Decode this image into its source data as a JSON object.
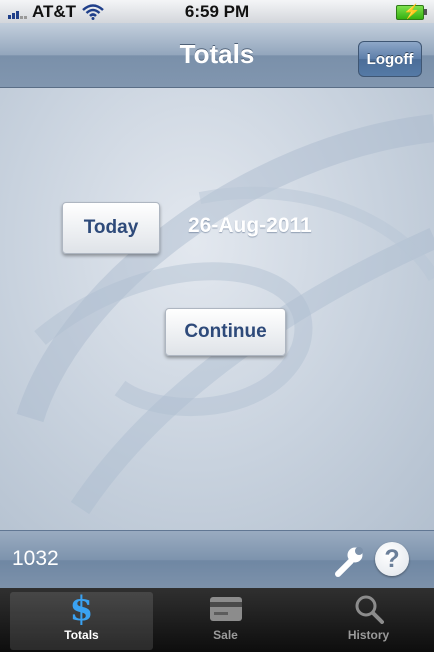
{
  "status_bar": {
    "carrier": "AT&T",
    "time": "6:59 PM"
  },
  "nav": {
    "title": "Totals",
    "logoff_label": "Logoff"
  },
  "main": {
    "today_label": "Today",
    "date": "26-Aug-2011",
    "continue_label": "Continue"
  },
  "info_bar": {
    "code": "1032",
    "help_glyph": "?"
  },
  "tabs": [
    {
      "label": "Totals",
      "icon": "dollar-icon",
      "active": true
    },
    {
      "label": "Sale",
      "icon": "card-icon",
      "active": false
    },
    {
      "label": "History",
      "icon": "search-icon",
      "active": false
    }
  ],
  "colors": {
    "nav_blue": "#8196af",
    "button_text": "#2e4a7a",
    "active_tab_icon": "#3aa2f2"
  }
}
